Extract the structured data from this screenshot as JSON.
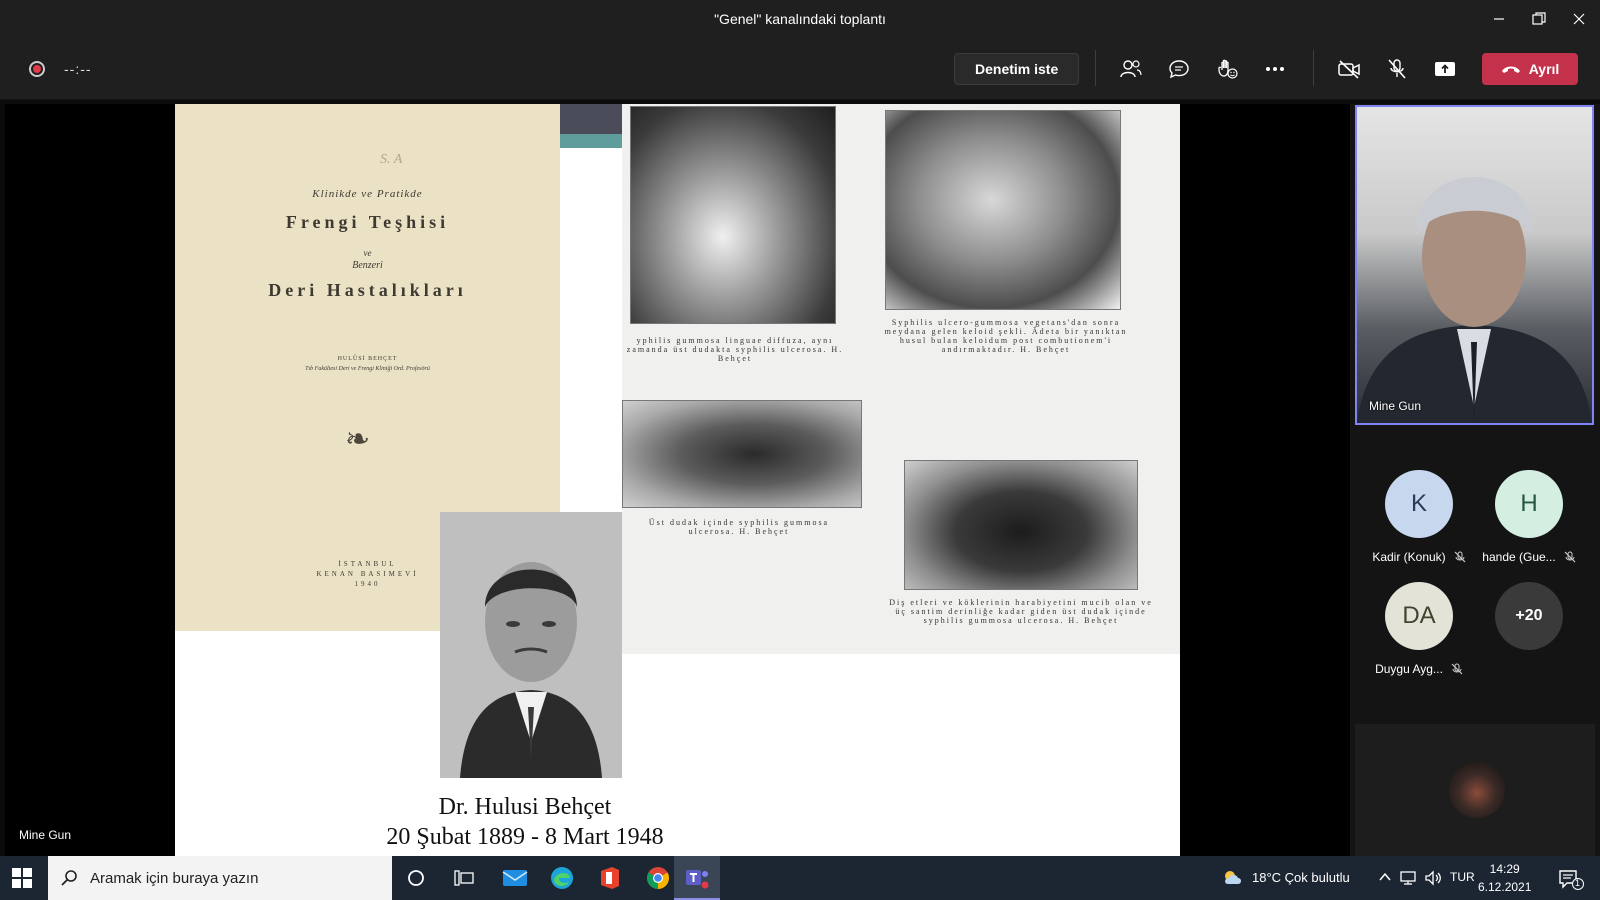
{
  "window": {
    "title": "\"Genel\" kanalındaki toplantı"
  },
  "toolbar": {
    "timer": "--:--",
    "request_control_label": "Denetim iste",
    "leave_label": "Ayrıl",
    "colors": {
      "leave": "#c4314b",
      "accent": "#7f85f5"
    }
  },
  "slide": {
    "book": {
      "handwriting": "S. A",
      "line1": "Klinikde ve Pratikde",
      "line2": "Frengi Teşhisi",
      "line3": "ve",
      "line4": "Benzeri",
      "line5": "Deri Hastalıkları",
      "author": "HULÛSİ BEHÇET",
      "author_title": "Tıb Fakültesi Deri ve Frengi Kliniği Ord. Profesörü",
      "publisher1": "İSTANBUL",
      "publisher2": "KENAN BASIMEVİ",
      "year": "1940"
    },
    "plate_captions": {
      "c1": "yphilis gummosa linguae diffuza, aynı zamanda üst dudakta syphilis ulcerosa. H. Behçet",
      "c2": "Syphilis ulcero-gummosa vegetans'dan sonra meydana gelen keloid şekli. Âdeta bir yanıktan husul bulan keloidum post combutionem'i andırmaktadır. H. Behçet",
      "c3": "Üst dudak içinde syphilis gummosa ulcerosa. H. Behçet",
      "c4": "Diş etleri ve köklerinin harabiyetini mucib olan ve üç santim derinliğe kadar giden üst dudak içinde syphilis gummosa ulcerosa. H. Behçet"
    },
    "caption_name": "Dr. Hulusi Behçet",
    "caption_dates": "20 Şubat 1889 - 8 Mart 1948"
  },
  "stage": {
    "presenter_name": "Mine Gun"
  },
  "participants": {
    "self": {
      "name": "Mine Gun"
    },
    "list": [
      {
        "initials": "K",
        "name": "Kadir (Konuk)",
        "bg": "#c7d7ee",
        "fg": "#2c3a57"
      },
      {
        "initials": "H",
        "name": "hande (Gue...",
        "bg": "#d4efe2",
        "fg": "#27573e"
      },
      {
        "initials": "DA",
        "name": "Duygu Ayg...",
        "bg": "#e3e3d8",
        "fg": "#43432f"
      },
      {
        "initials": "+20",
        "name": "",
        "bg": "#3a3a3a",
        "fg": "#ffffff"
      }
    ]
  },
  "taskbar": {
    "search_placeholder": "Aramak için buraya yazın",
    "weather": "18°C  Çok bulutlu",
    "language": "TUR",
    "time": "14:29",
    "date": "6.12.2021",
    "notification_count": "1"
  }
}
